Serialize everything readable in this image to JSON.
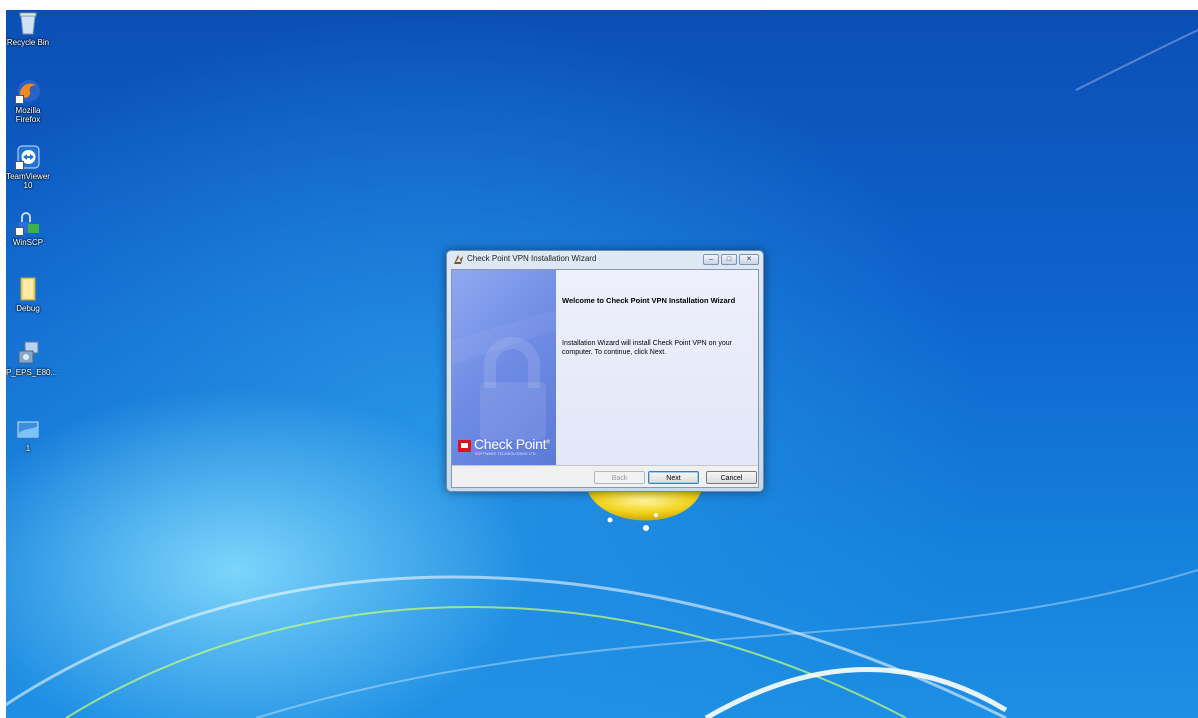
{
  "desktop": {
    "icons": [
      {
        "label": "Recycle Bin",
        "icon": "recycle-bin-icon"
      },
      {
        "label": "Mozilla\nFirefox",
        "icon": "firefox-icon"
      },
      {
        "label": "TeamViewer\n10",
        "icon": "teamviewer-icon"
      },
      {
        "label": "WinSCP",
        "icon": "winscp-icon"
      },
      {
        "label": "Debug",
        "icon": "folder-icon"
      },
      {
        "label": "P_EPS_E80...",
        "icon": "installer-icon"
      },
      {
        "label": "1",
        "icon": "image-file-icon"
      }
    ]
  },
  "dialog": {
    "title": "Check Point VPN Installation Wizard",
    "caption_buttons": {
      "minimize": "–",
      "maximize": "□",
      "close": "✕"
    },
    "banner": {
      "logo_text": "Check Point",
      "logo_trademark": "®",
      "logo_subtext": "SOFTWARE TECHNOLOGIES LTD."
    },
    "heading": "Welcome to Check Point VPN Installation Wizard",
    "body": "Installation Wizard will install Check Point VPN on your computer. To continue, click Next.",
    "buttons": {
      "back": "Back",
      "next": "Next",
      "cancel": "Cancel"
    }
  },
  "colors": {
    "accent": "#0e63cc",
    "logo_red": "#d9141b",
    "banner": "#6e8be4"
  }
}
